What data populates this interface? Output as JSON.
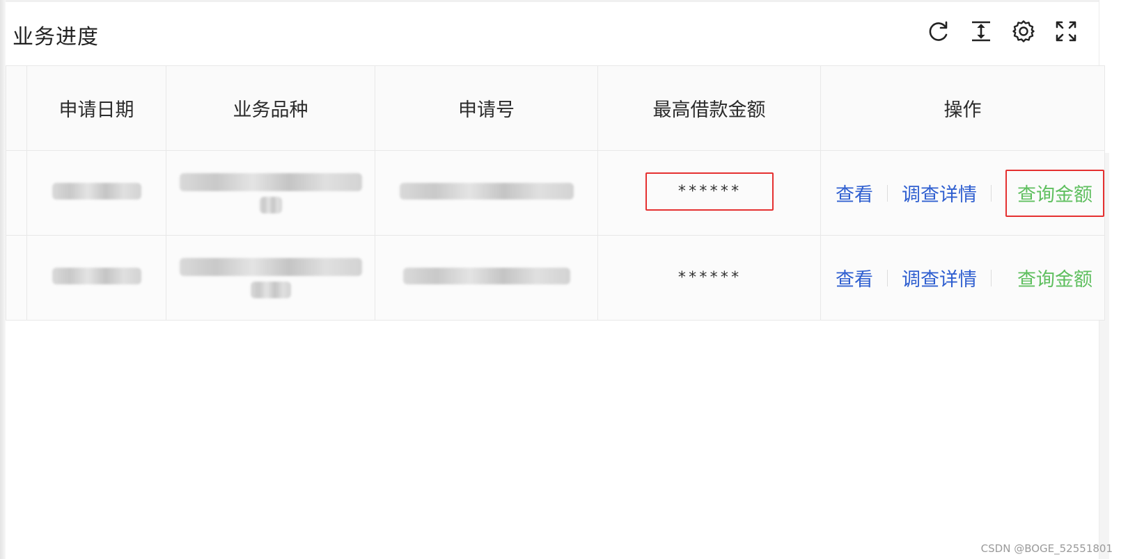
{
  "card": {
    "title": "业务进度"
  },
  "toolbar": {
    "icons": [
      "reload-icon",
      "column-height-icon",
      "setting-icon",
      "fullscreen-icon"
    ]
  },
  "table": {
    "columns": [
      "申请日期",
      "业务品种",
      "申请号",
      "最高借款金额",
      "操作"
    ],
    "rows": [
      {
        "apply_date": "",
        "business_type": "",
        "apply_no": "",
        "max_amount": "******",
        "actions": {
          "view": "查看",
          "detail": "调查详情",
          "query": "查询金额"
        }
      },
      {
        "apply_date": "",
        "business_type": "",
        "apply_no": "",
        "max_amount": "******",
        "actions": {
          "view": "查看",
          "detail": "调查详情",
          "query": "查询金额"
        }
      }
    ]
  },
  "colors": {
    "link": "#2f5fd0",
    "query_link": "#5fbf5f",
    "highlight": "#e53030"
  },
  "watermark": "CSDN @BOGE_52551801"
}
